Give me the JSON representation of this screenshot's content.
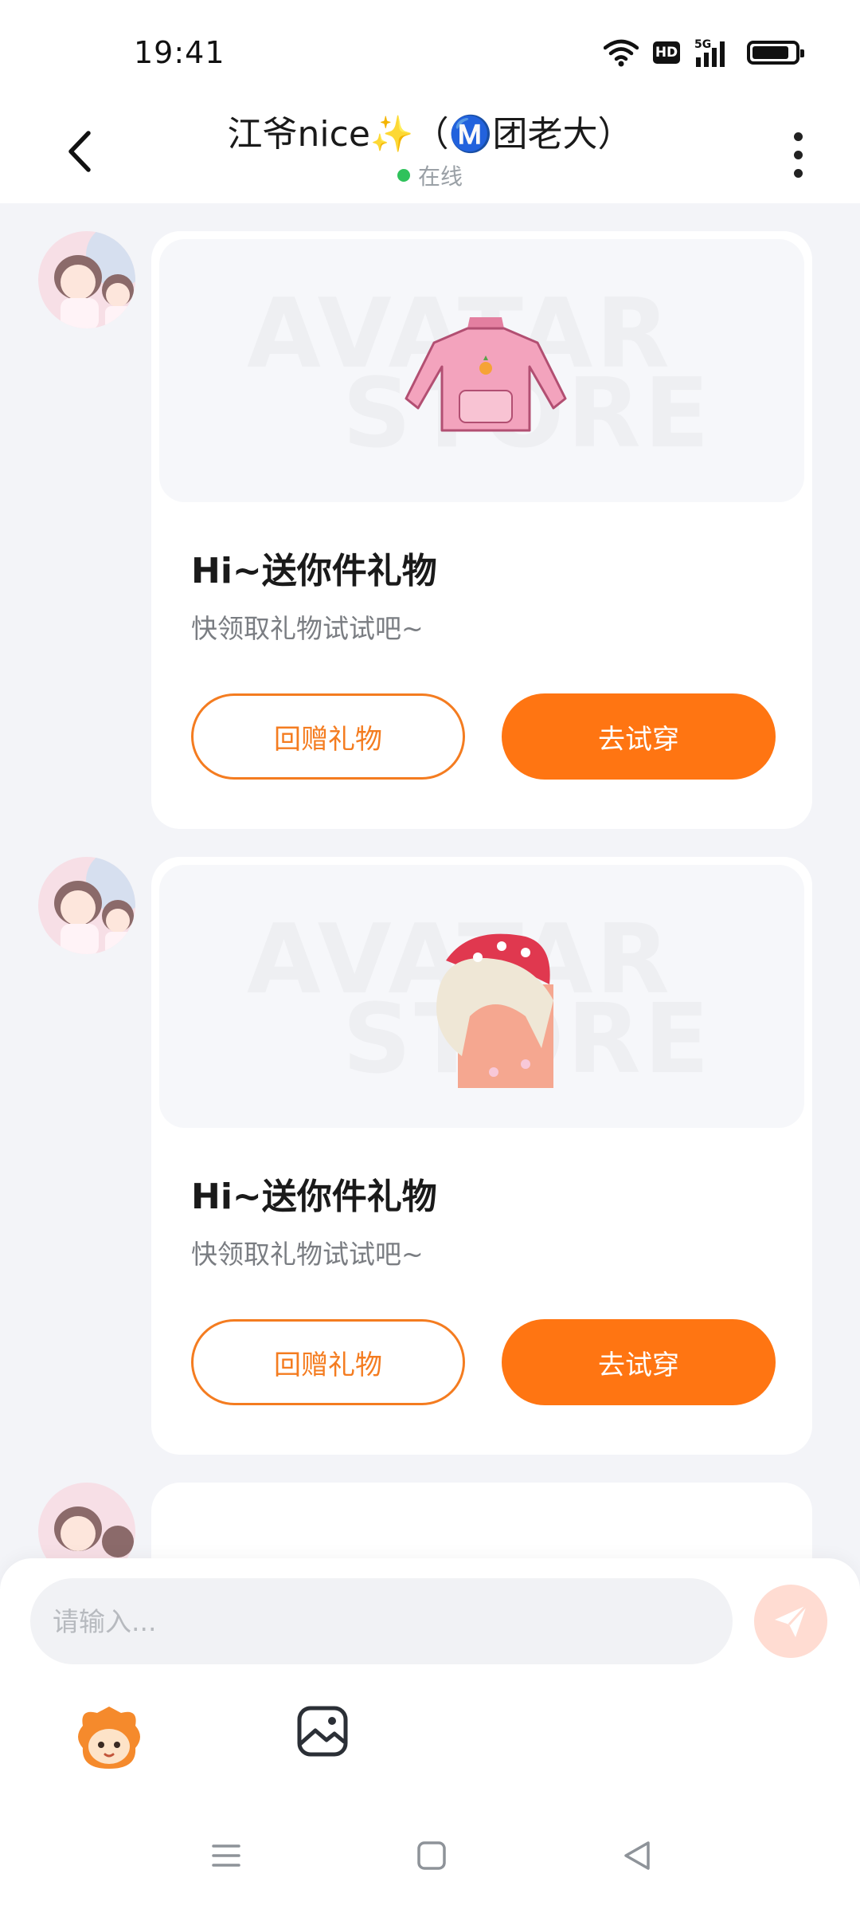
{
  "status_bar": {
    "time": "19:41",
    "hd": "HD",
    "network": "5G"
  },
  "header": {
    "title": "江爷nice✨（Ⓜ️团老大）",
    "online_status": "在线"
  },
  "messages": [
    {
      "title": "Hi~送你件礼物",
      "subtitle": "快领取礼物试试吧~",
      "return_button": "回赠礼物",
      "try_button": "去试穿",
      "watermark_line1": "AVATAR",
      "watermark_line2": "STORE",
      "item": "pink-shirt"
    },
    {
      "title": "Hi~送你件礼物",
      "subtitle": "快领取礼物试试吧~",
      "return_button": "回赠礼物",
      "try_button": "去试穿",
      "watermark_line1": "AVATAR",
      "watermark_line2": "STORE",
      "item": "hair-headpiece"
    }
  ],
  "input": {
    "placeholder": "请输入..."
  },
  "colors": {
    "accent": "#ff7512",
    "online": "#2fc25b",
    "send_button": "#ffdcd2"
  }
}
